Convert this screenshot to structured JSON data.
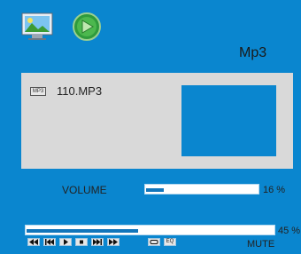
{
  "header": {
    "title": "Mp3",
    "icons": [
      "photo-icon",
      "play-icon"
    ]
  },
  "now_playing": {
    "badge": "MP3",
    "file_name": "110.MP3"
  },
  "volume": {
    "label": "VOLUME",
    "percent_text": "16 %",
    "level": 0.16
  },
  "progress": {
    "percent_text": "45 %",
    "level": 0.45
  },
  "controls": {
    "buttons": [
      "rewind",
      "previous",
      "play",
      "stop",
      "next",
      "fast-forward"
    ],
    "repeat_icon": "repeat-icon",
    "eq_label": "EQ",
    "mute_label": "MUTE"
  },
  "colors": {
    "background": "#0a86cf",
    "panel": "#d9d9d9",
    "bar_fill": "#1276bb"
  }
}
